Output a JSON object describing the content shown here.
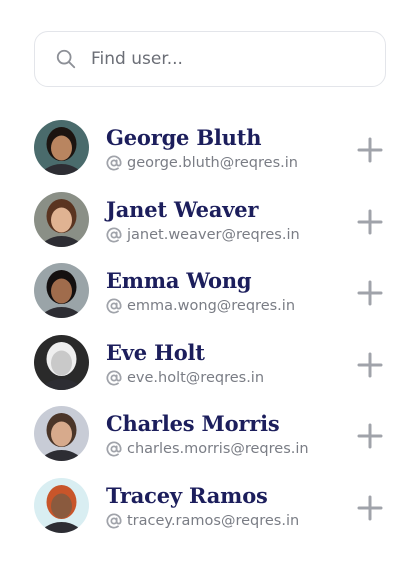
{
  "search": {
    "placeholder": "Find user..."
  },
  "users": [
    {
      "name": "George Bluth",
      "email": "george.bluth@reqres.in",
      "avatar_bg": "#4a6b6c",
      "skin": "#b98560",
      "hair": "#1c1410"
    },
    {
      "name": "Janet Weaver",
      "email": "janet.weaver@reqres.in",
      "avatar_bg": "#8a8f86",
      "skin": "#e0b392",
      "hair": "#5a3420"
    },
    {
      "name": "Emma Wong",
      "email": "emma.wong@reqres.in",
      "avatar_bg": "#9aa4a8",
      "skin": "#a06c4c",
      "hair": "#141010"
    },
    {
      "name": "Eve Holt",
      "email": "eve.holt@reqres.in",
      "avatar_bg": "#2a2a2a",
      "skin": "#c9c9c9",
      "hair": "#efefef"
    },
    {
      "name": "Charles Morris",
      "email": "charles.morris@reqres.in",
      "avatar_bg": "#c8ccd6",
      "skin": "#d7aa8c",
      "hair": "#4a3528"
    },
    {
      "name": "Tracey Ramos",
      "email": "tracey.ramos@reqres.in",
      "avatar_bg": "#d9eef2",
      "skin": "#8a5a3e",
      "hair": "#c8552a"
    }
  ],
  "colors": {
    "name": "#1c1e5c",
    "email": "#7a7d85",
    "icon": "#a0a3aa"
  },
  "icons": {
    "search": "search-icon",
    "at": "at-sign-icon",
    "add": "plus-icon"
  }
}
